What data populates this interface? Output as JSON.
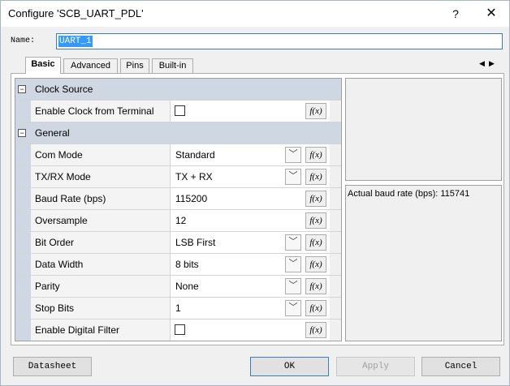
{
  "window": {
    "title": "Configure 'SCB_UART_PDL'",
    "help": "?",
    "close": "✕"
  },
  "name": {
    "label": "Name:",
    "value": "UART_1"
  },
  "tabs": [
    {
      "label": "Basic",
      "active": true
    },
    {
      "label": "Advanced",
      "active": false
    },
    {
      "label": "Pins",
      "active": false
    },
    {
      "label": "Built-in",
      "active": false
    }
  ],
  "tab_scroll": {
    "left": "◀",
    "right": "▶"
  },
  "grid": {
    "groups": [
      {
        "label": "Clock Source",
        "toggle": "−",
        "rows": [
          {
            "label": "Enable Clock from Terminal",
            "type": "checkbox",
            "checked": false
          }
        ]
      },
      {
        "label": "General",
        "toggle": "−",
        "rows": [
          {
            "label": "Com Mode",
            "type": "dropdown",
            "value": "Standard"
          },
          {
            "label": "TX/RX Mode",
            "type": "dropdown",
            "value": "TX + RX"
          },
          {
            "label": "Baud Rate (bps)",
            "type": "text",
            "value": "115200"
          },
          {
            "label": "Oversample",
            "type": "text",
            "value": "12"
          },
          {
            "label": "Bit Order",
            "type": "dropdown",
            "value": "LSB First"
          },
          {
            "label": "Data Width",
            "type": "dropdown",
            "value": "8 bits"
          },
          {
            "label": "Parity",
            "type": "dropdown",
            "value": "None"
          },
          {
            "label": "Stop Bits",
            "type": "dropdown",
            "value": "1"
          },
          {
            "label": "Enable Digital Filter",
            "type": "checkbox",
            "checked": false
          }
        ]
      }
    ],
    "fx_label": "f(x)",
    "dropdown_glyph": "﹀"
  },
  "info": {
    "text": "Actual baud rate (bps): 115741"
  },
  "buttons": {
    "datasheet": "Datasheet",
    "ok": "OK",
    "apply": "Apply",
    "cancel": "Cancel"
  }
}
